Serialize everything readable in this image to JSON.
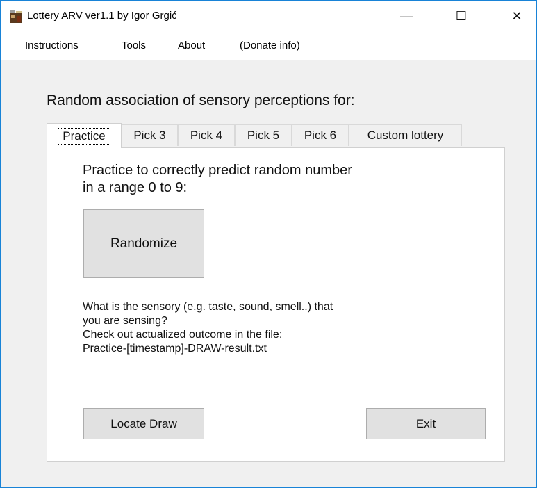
{
  "window": {
    "title": "Lottery ARV ver1.1 by Igor Grgić",
    "controls": {
      "minimize": "—",
      "maximize": "☐",
      "close": "✕"
    }
  },
  "menu": {
    "items": [
      "Instructions",
      "Tools",
      "About",
      "(Donate info)"
    ]
  },
  "heading": "Random association of sensory perceptions for:",
  "tabs": [
    {
      "label": "Practice",
      "active": true
    },
    {
      "label": "Pick 3",
      "active": false
    },
    {
      "label": "Pick 4",
      "active": false
    },
    {
      "label": "Pick 5",
      "active": false
    },
    {
      "label": "Pick 6",
      "active": false
    },
    {
      "label": "Custom lottery",
      "active": false
    }
  ],
  "practice": {
    "intro_line1": "Practice to correctly predict random number",
    "intro_line2": "in a range 0 to 9:",
    "randomize_label": "Randomize",
    "info_lines": [
      "What is the sensory (e.g. taste, sound, smell..) that",
      "you are sensing?",
      "Check out actualized outcome in the file:",
      "Practice-[timestamp]-DRAW-result.txt"
    ],
    "locate_label": "Locate Draw",
    "exit_label": "Exit"
  },
  "colors": {
    "window_border": "#1883d7",
    "button_face": "#e1e1e1",
    "button_border": "#adadad"
  },
  "icons": {
    "app": "lottery-app-icon"
  }
}
